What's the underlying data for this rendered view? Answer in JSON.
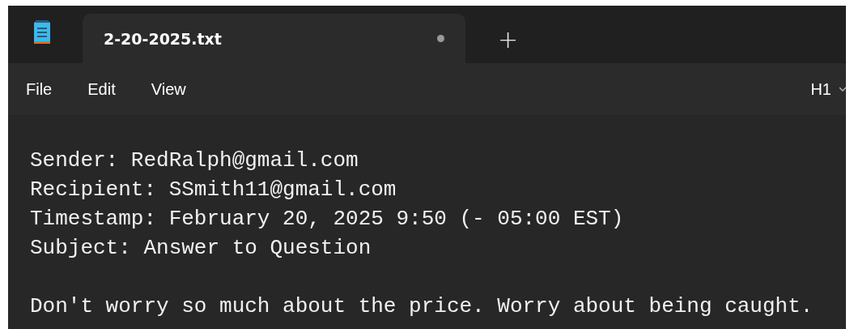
{
  "tabs": [
    {
      "title": "2-20-2025.txt",
      "unsaved": true,
      "selected": true
    }
  ],
  "new_tab": "+",
  "menu": [
    "File",
    "Edit",
    "View"
  ],
  "format": {
    "label": "H1"
  },
  "editor": {
    "paragraphs": [
      {
        "lines": [
          "Sender: RedRalph@gmail.com",
          "Recipient: SSmith11@gmail.com",
          "Timestamp: February 20, 2025 9:50 (- 05:00 EST)",
          "Subject: Answer to Question"
        ]
      },
      {
        "lines": [
          "Don't worry so much about the price. Worry about being caught."
        ]
      }
    ]
  }
}
